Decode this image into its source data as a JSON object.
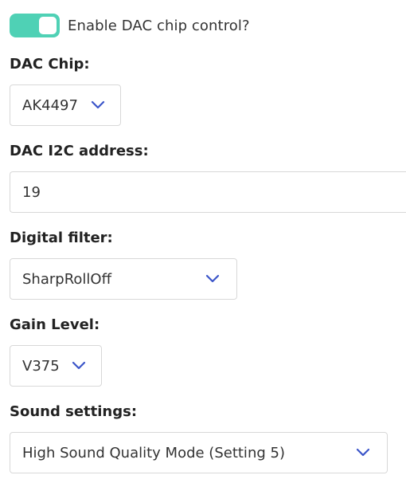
{
  "toggle": {
    "label": "Enable DAC chip control?",
    "enabled": true,
    "accent_color": "#4fd1b5"
  },
  "dac_chip": {
    "label": "DAC Chip:",
    "value": "AK4497",
    "icon": "chevron-down-icon"
  },
  "i2c_address": {
    "label": "DAC I2C address:",
    "value": "19"
  },
  "digital_filter": {
    "label": "Digital filter:",
    "value": "SharpRollOff",
    "icon": "chevron-down-icon"
  },
  "gain_level": {
    "label": "Gain Level:",
    "value": "V375",
    "icon": "chevron-down-icon"
  },
  "sound_settings": {
    "label": "Sound settings:",
    "value": "High Sound Quality Mode (Setting 5)",
    "icon": "chevron-down-icon"
  },
  "colors": {
    "chevron": "#3b55c9",
    "border": "#d8d8d8"
  }
}
